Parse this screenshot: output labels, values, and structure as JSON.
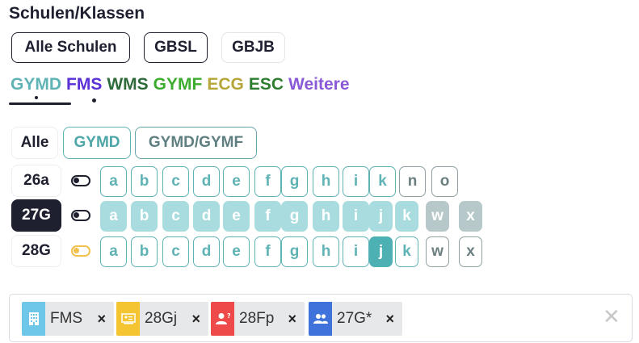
{
  "title": "Schulen/Klassen",
  "schools": [
    {
      "label": "Alle Schulen",
      "state": "active"
    },
    {
      "label": "GBSL",
      "state": "active"
    },
    {
      "label": "GBJB",
      "state": "inactive"
    }
  ],
  "tabs": [
    {
      "label": "GYMD",
      "color": "#5fb3b5"
    },
    {
      "label": "FMS",
      "color": "#5a2fd6"
    },
    {
      "label": "WMS",
      "color": "#2f6b3a"
    },
    {
      "label": "GYMF",
      "color": "#3cac2e"
    },
    {
      "label": "ECG",
      "color": "#b6a53a"
    },
    {
      "label": "ESC",
      "color": "#2f7d2f"
    },
    {
      "label": "Weitere",
      "color": "#8a5ad6"
    }
  ],
  "filters": {
    "all": "Alle",
    "gymd": "GYMD",
    "gymd_gymf": "GYMD/GYMF"
  },
  "rows": [
    {
      "label": "26a",
      "selected": false,
      "toggle": "off",
      "letters": [
        {
          "l": "a",
          "s": "outline"
        },
        {
          "l": "b",
          "s": "outline"
        },
        {
          "l": "c",
          "s": "outline"
        },
        {
          "l": "d",
          "s": "outline"
        },
        {
          "l": "e",
          "s": "outline"
        },
        {
          "l": "f",
          "s": "outline"
        },
        {
          "l": "g",
          "s": "outline"
        },
        {
          "l": "h",
          "s": "outline"
        },
        {
          "l": "i",
          "s": "outline"
        },
        {
          "l": "k",
          "s": "outline"
        },
        {
          "l": "n",
          "s": "outline-grey"
        },
        {
          "l": "o",
          "s": "outline-grey"
        }
      ]
    },
    {
      "label": "27G",
      "selected": true,
      "toggle": "off",
      "letters": [
        {
          "l": "a",
          "s": "light"
        },
        {
          "l": "b",
          "s": "light"
        },
        {
          "l": "c",
          "s": "light"
        },
        {
          "l": "d",
          "s": "light"
        },
        {
          "l": "e",
          "s": "light"
        },
        {
          "l": "f",
          "s": "light"
        },
        {
          "l": "g",
          "s": "light"
        },
        {
          "l": "h",
          "s": "light"
        },
        {
          "l": "i",
          "s": "light"
        },
        {
          "l": "j",
          "s": "light"
        },
        {
          "l": "k",
          "s": "light"
        },
        {
          "l": "w",
          "s": "light-grey"
        },
        {
          "l": "x",
          "s": "light-grey"
        }
      ]
    },
    {
      "label": "28G",
      "selected": false,
      "toggle": "on",
      "letters": [
        {
          "l": "a",
          "s": "outline"
        },
        {
          "l": "b",
          "s": "outline"
        },
        {
          "l": "c",
          "s": "outline"
        },
        {
          "l": "d",
          "s": "outline"
        },
        {
          "l": "e",
          "s": "outline"
        },
        {
          "l": "f",
          "s": "outline"
        },
        {
          "l": "g",
          "s": "outline"
        },
        {
          "l": "h",
          "s": "outline"
        },
        {
          "l": "i",
          "s": "outline"
        },
        {
          "l": "j",
          "s": "solid"
        },
        {
          "l": "k",
          "s": "outline"
        },
        {
          "l": "w",
          "s": "outline-grey"
        },
        {
          "l": "x",
          "s": "outline-grey"
        }
      ]
    }
  ],
  "chips": [
    {
      "label": "FMS",
      "icon": "building-icon",
      "color": "#6ec6e8"
    },
    {
      "label": "28Gj",
      "icon": "classroom-icon",
      "color": "#f4c431"
    },
    {
      "label": "28Fp",
      "icon": "user-question-icon",
      "color": "#ef4a4a"
    },
    {
      "label": "27G*",
      "icon": "users-icon",
      "color": "#3f73db"
    }
  ],
  "chip_remove": "×",
  "clear_all": "✕"
}
